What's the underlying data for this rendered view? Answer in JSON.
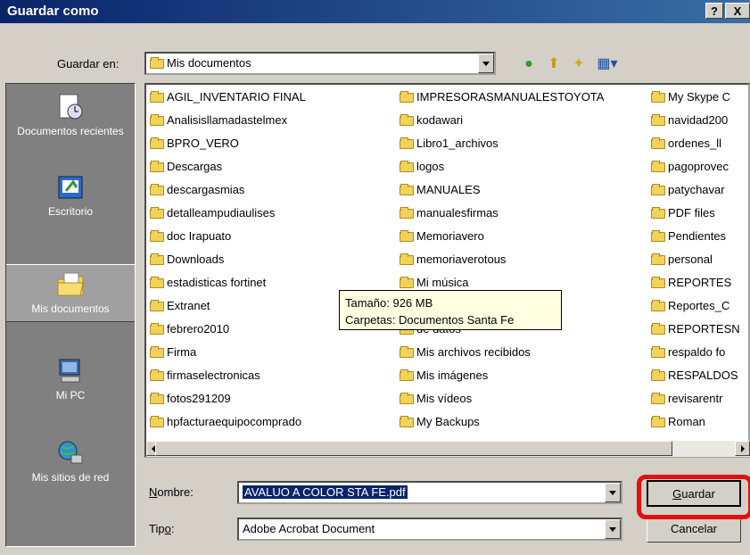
{
  "title": "Guardar como",
  "title_buttons": {
    "help": "?",
    "close": "X"
  },
  "save_in": {
    "label": "Guardar en:",
    "value": "Mis documentos"
  },
  "places": [
    {
      "label": "Documentos recientes",
      "icon": "recent-documents-icon"
    },
    {
      "label": "Escritorio",
      "icon": "desktop-icon"
    },
    {
      "label": "Mis documentos",
      "icon": "my-documents-icon"
    },
    {
      "label": "Mi PC",
      "icon": "my-computer-icon"
    },
    {
      "label": "Mis sitios de red",
      "icon": "network-places-icon"
    }
  ],
  "columns": [
    [
      "AGIL_INVENTARIO FINAL",
      "Analisisllamadastelmex",
      "BPRO_VERO",
      "Descargas",
      "descargasmias",
      "detalleampudiaulises",
      "doc Irapuato",
      "Downloads",
      "estadisticas fortinet",
      "Extranet",
      "febrero2010",
      "Firma",
      "firmaselectronicas",
      "fotos291209",
      "hpfacturaequipocomprado"
    ],
    [
      "IMPRESORASMANUALESTOYOTA",
      "kodawari",
      "Libro1_archivos",
      "logos",
      "MANUALES",
      "manualesfirmas",
      "Memoriavero",
      "memoriaverotous",
      "Mi música",
      "",
      "de datos",
      "Mis archivos recibidos",
      "Mis imágenes",
      "Mis vídeos",
      "My Backups"
    ],
    [
      "My Skype C",
      "navidad200",
      "ordenes_ll",
      "pagoprovec",
      "patychavar",
      "PDF files",
      "Pendientes",
      "personal",
      "REPORTES",
      "Reportes_C",
      "REPORTESN",
      "respaldo fo",
      "RESPALDOS",
      "revisarentr",
      "Roman"
    ]
  ],
  "tooltip": {
    "line1": "Tamaño: 926 MB",
    "line2": "Carpetas: Documentos Santa Fe"
  },
  "filename": {
    "label": "Nombre:",
    "value": "AVALUO A COLOR STA FE.pdf"
  },
  "filetype": {
    "label": "Tipo:",
    "value": "Adobe Acrobat Document"
  },
  "buttons": {
    "save": "Guardar",
    "cancel": "Cancelar"
  },
  "colors": {
    "title_bar": "#0a246a",
    "highlight": "#e21010",
    "folder": "#f2d35a"
  }
}
